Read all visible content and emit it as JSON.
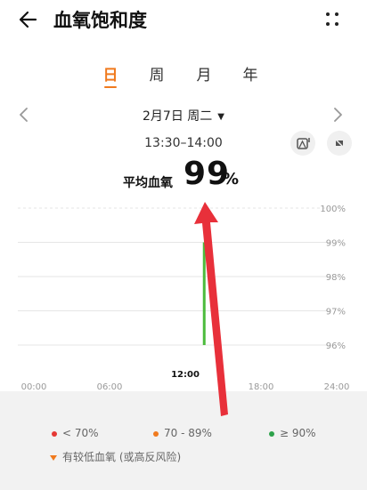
{
  "header": {
    "title": "血氧饱和度",
    "back_icon": "arrow-left-icon",
    "more_icon": "more-dots-icon"
  },
  "tabs": [
    {
      "label": "日",
      "active": true
    },
    {
      "label": "周",
      "active": false
    },
    {
      "label": "月",
      "active": false
    },
    {
      "label": "年",
      "active": false
    }
  ],
  "date": {
    "label": "2月7日 周二",
    "caret": "▼"
  },
  "time_range": "13:30–14:00",
  "summary": {
    "label": "平均血氧",
    "value": "99",
    "unit": "%"
  },
  "colors": {
    "accent": "#f07a1e",
    "bar": "#4cbb3c",
    "low": "#e53935",
    "mid": "#f07a1e",
    "normal": "#2ea24b",
    "annotation_arrow": "#e8303a"
  },
  "chart_data": {
    "type": "bar",
    "y_ticks": [
      "100%",
      "99%",
      "98%",
      "97%",
      "96%"
    ],
    "ylim": [
      96,
      100
    ],
    "x_ticks": [
      "00:00",
      "06:00",
      "12:00",
      "18:00",
      "24:00"
    ],
    "highlight_x": "12:00",
    "series": [
      {
        "x": "13:30",
        "low": 96,
        "high": 99,
        "avg": 99
      }
    ]
  },
  "legend": [
    {
      "label": "< 70%",
      "color": "#e53935"
    },
    {
      "label": "70 - 89%",
      "color": "#f07a1e"
    },
    {
      "label": "≥ 90%",
      "color": "#2ea24b"
    }
  ],
  "note": "有较低血氧 (或高反风险)"
}
